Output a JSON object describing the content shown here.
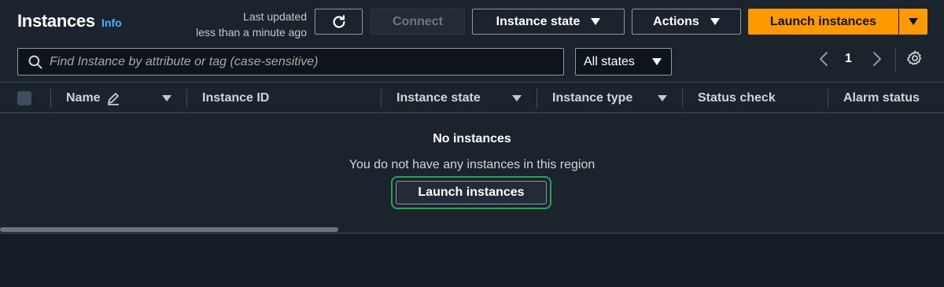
{
  "header": {
    "title": "Instances",
    "info_link": "Info",
    "last_updated_line1": "Last updated",
    "last_updated_line2": "less than a minute ago"
  },
  "toolbar": {
    "connect_label": "Connect",
    "instance_state_label": "Instance state",
    "actions_label": "Actions",
    "launch_label": "Launch instances"
  },
  "search": {
    "placeholder": "Find Instance by attribute or tag (case-sensitive)",
    "value": ""
  },
  "filter": {
    "selected": "All states"
  },
  "pagination": {
    "current_page": "1"
  },
  "table": {
    "columns": [
      "Name",
      "Instance ID",
      "Instance state",
      "Instance type",
      "Status check",
      "Alarm status"
    ]
  },
  "empty_state": {
    "title": "No instances",
    "message": "You do not have any instances in this region",
    "button_label": "Launch instances"
  },
  "colors": {
    "primary_button": "#ff9900",
    "link": "#42b4ff",
    "focus_ring": "#29a35a",
    "panel_background": "#1b232d"
  },
  "icons": {
    "refresh": "refresh-icon",
    "search": "search-icon",
    "edit": "pencil-icon",
    "settings": "gear-icon",
    "prev": "chevron-left-icon",
    "next": "chevron-right-icon"
  }
}
